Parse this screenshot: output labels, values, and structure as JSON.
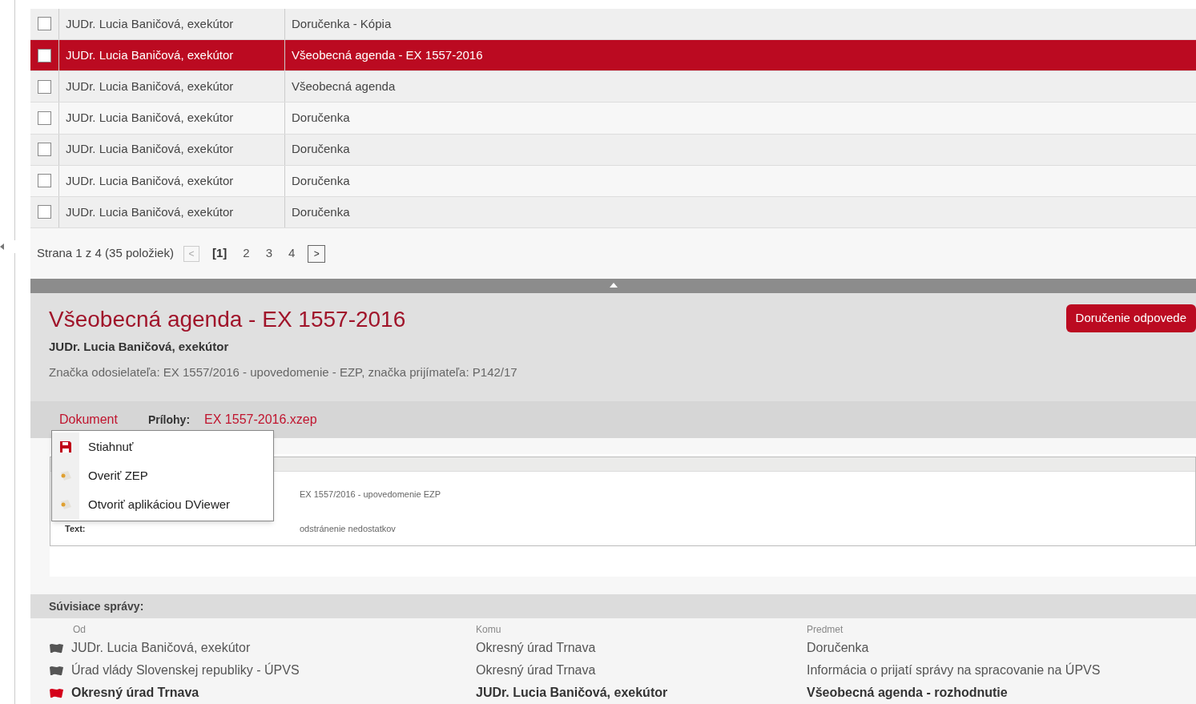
{
  "messages": {
    "rows": [
      {
        "checked": false,
        "selected": false,
        "sender": "JUDr. Lucia Baničová, exekútor",
        "subject": "Doručenka - Kópia"
      },
      {
        "checked": false,
        "selected": true,
        "sender": "JUDr. Lucia Baničová, exekútor",
        "subject": "Všeobecná agenda - EX 1557-2016"
      },
      {
        "checked": false,
        "selected": false,
        "sender": "JUDr. Lucia Baničová, exekútor",
        "subject": "Všeobecná agenda"
      },
      {
        "checked": false,
        "selected": false,
        "sender": "JUDr. Lucia Baničová, exekútor",
        "subject": "Doručenka"
      },
      {
        "checked": false,
        "selected": false,
        "sender": "JUDr. Lucia Baničová, exekútor",
        "subject": "Doručenka"
      },
      {
        "checked": false,
        "selected": false,
        "sender": "JUDr. Lucia Baničová, exekútor",
        "subject": "Doručenka"
      },
      {
        "checked": false,
        "selected": false,
        "sender": "JUDr. Lucia Baničová, exekútor",
        "subject": "Doručenka"
      }
    ],
    "pager": {
      "summary": "Strana 1 z 4 (35 položiek)",
      "prev": "<",
      "next": ">",
      "pages": [
        {
          "label": "[1]",
          "selected": true
        },
        {
          "label": "2",
          "selected": false
        },
        {
          "label": "3",
          "selected": false
        },
        {
          "label": "4",
          "selected": false
        }
      ]
    }
  },
  "detail": {
    "title": "Všeobecná agenda - EX 1557-2016",
    "sender": "JUDr. Lucia Baničová, exekútor",
    "reference": "Značka odosielateľa: EX 1557/2016 - upovedomenie - EZP, značka prijímateľa: P142/17",
    "reply_button": "Doručenie odpovede",
    "tabs": {
      "document": "Dokument",
      "attachments_label": "Prílohy:",
      "attachment": "EX 1557-2016.xzep"
    },
    "menu": [
      {
        "kind": "save",
        "label": "Stiahnuť"
      },
      {
        "kind": "seal",
        "label": "Overiť ZEP"
      },
      {
        "kind": "seal",
        "label": "Otvoriť aplikáciou DViewer"
      }
    ],
    "document": {
      "subject_value": "EX 1557/2016 - upovedomenie EZP",
      "text_label": "Text:",
      "text_value": "odstránenie nedostatkov"
    }
  },
  "related": {
    "title": "Súvisiace správy:",
    "columns": [
      "Od",
      "Komu",
      "Predmet"
    ],
    "rows": [
      {
        "unread": false,
        "from": "JUDr. Lucia Baničová, exekútor",
        "to": "Okresný úrad Trnava",
        "subject": "Doručenka"
      },
      {
        "unread": false,
        "from": "Úrad vlády Slovenskej republiky - ÚPVS",
        "to": "Okresný úrad Trnava",
        "subject": "Informácia o prijatí správy na spracovanie na ÚPVS"
      },
      {
        "unread": true,
        "from": "Okresný úrad Trnava",
        "to": "JUDr. Lucia Baničová, exekútor",
        "subject": "Všeobecná agenda - rozhodnutie"
      }
    ]
  }
}
